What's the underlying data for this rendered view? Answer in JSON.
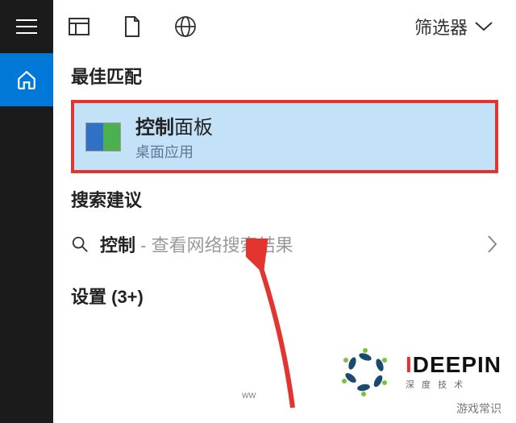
{
  "topbar": {
    "filter_label": "筛选器"
  },
  "sections": {
    "best_match_label": "最佳匹配",
    "search_suggest_label": "搜索建议",
    "settings_label": "设置 (3+)"
  },
  "best_match": {
    "title_bold": "控制",
    "title_rest": "面板",
    "subtitle": "桌面应用"
  },
  "web_search": {
    "query": "控制",
    "separator": " - ",
    "hint": "查看网络搜索结果"
  },
  "watermark": {
    "brand_i": "I",
    "brand_rest": "DEEPIN",
    "small": "ww",
    "corner": "游戏常识"
  }
}
